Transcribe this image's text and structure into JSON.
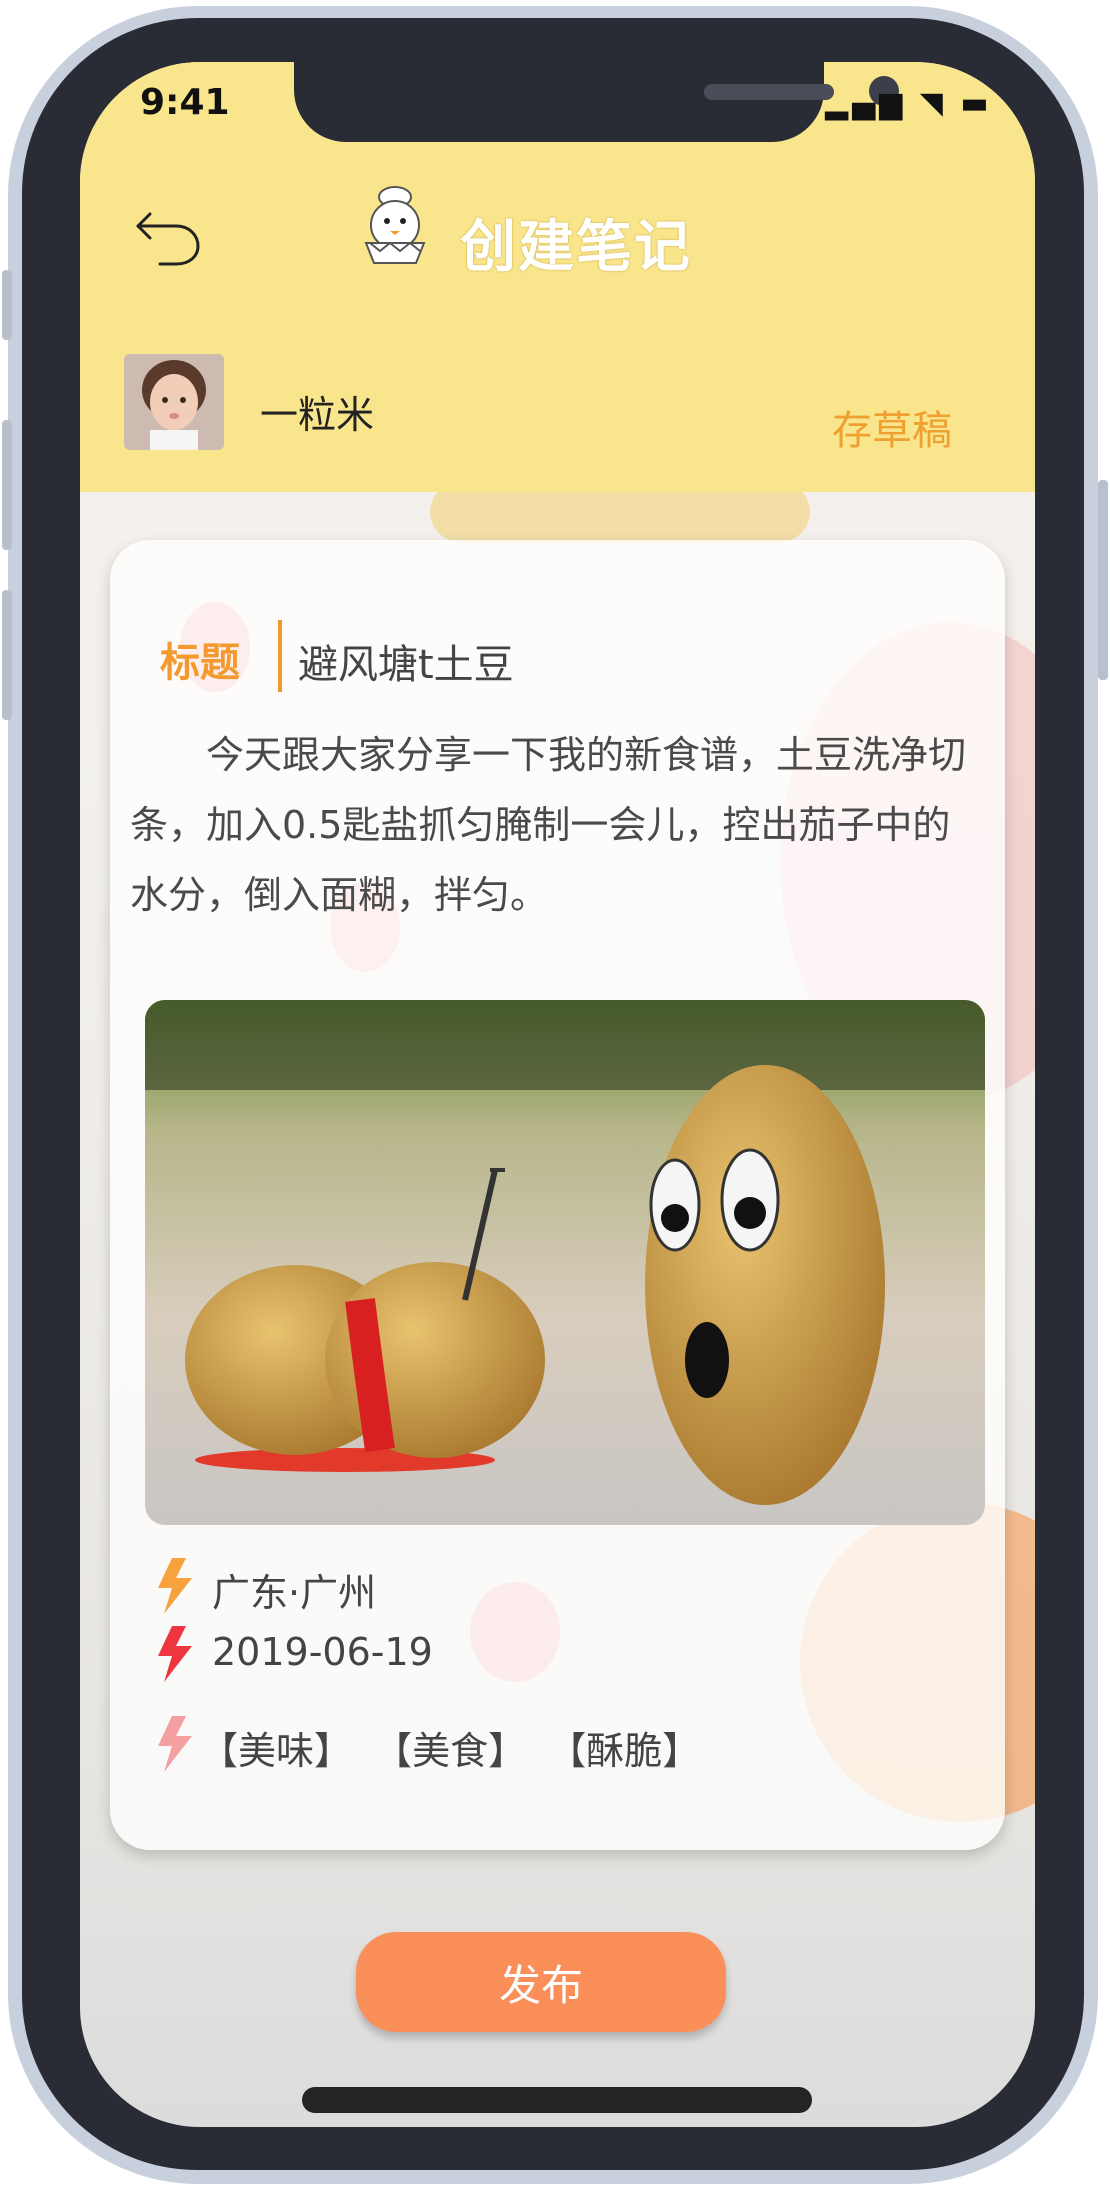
{
  "status_bar": {
    "time": "9:41",
    "icons": "▂▄▆ ◥ ▬"
  },
  "header": {
    "title": "创建笔记",
    "back_icon": "undo-arrow-icon",
    "logo_icon": "chef-chick-logo"
  },
  "user": {
    "name": "一粒米",
    "avatar_icon": "user-avatar",
    "save_draft_label": "存草稿"
  },
  "note": {
    "title_label": "标题",
    "title_value": "避风塘t土豆",
    "body": "今天跟大家分享一下我的新食谱，土豆洗净切条，加入0.5匙盐抓匀腌制一会儿，控出茄子中的水分，倒入面糊，拌匀。",
    "location": "广东·广州",
    "date": "2019-06-19",
    "tags": [
      "【美味】",
      "【美食】",
      "【酥脆】"
    ]
  },
  "actions": {
    "publish_label": "发布"
  },
  "colors": {
    "header_bg": "#f9e58b",
    "accent_orange": "#f29a2e",
    "draft_orange": "#f0a030",
    "publish_bg": "#fb8f5a",
    "bolt_orange": "#f7a23c",
    "bolt_red": "#ee3540",
    "bolt_pink": "#f4a0a0"
  }
}
